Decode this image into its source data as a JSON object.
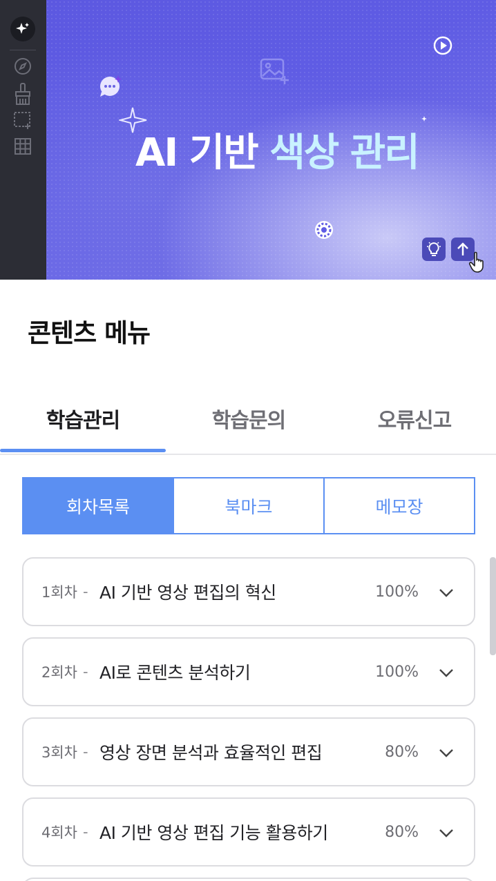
{
  "hero": {
    "title_main": "AI 기반 ",
    "title_highlight": "색상 관리",
    "toolbar_icons": [
      "magic-sparkle-icon",
      "compass-icon",
      "brush-icon",
      "crop-add-icon",
      "grid-icon"
    ],
    "colors": {
      "gradient_start": "#5c58e0",
      "highlight_text": "#c9f2ff",
      "toolbar_bg": "#2c2d35"
    }
  },
  "content_menu": {
    "heading": "콘텐츠 메뉴",
    "tabs": [
      {
        "label": "학습관리",
        "active": true
      },
      {
        "label": "학습문의",
        "active": false
      },
      {
        "label": "오류신고",
        "active": false
      }
    ],
    "segments": [
      {
        "label": "회차목록",
        "active": true
      },
      {
        "label": "북마크",
        "active": false
      },
      {
        "label": "메모장",
        "active": false
      }
    ],
    "sessions": [
      {
        "number": "1회차",
        "dash": "-",
        "title": "AI 기반 영상 편집의 혁신",
        "progress": "100%"
      },
      {
        "number": "2회차",
        "dash": "-",
        "title": "AI로 콘텐츠 분석하기",
        "progress": "100%"
      },
      {
        "number": "3회차",
        "dash": "-",
        "title": "영상 장면 분석과 효율적인 편집",
        "progress": "80%"
      },
      {
        "number": "4회차",
        "dash": "-",
        "title": "AI 기반 영상 편집 기능 활용하기",
        "progress": "80%"
      }
    ]
  },
  "colors": {
    "accent": "#5b8ff2",
    "border": "#dcdce0"
  }
}
